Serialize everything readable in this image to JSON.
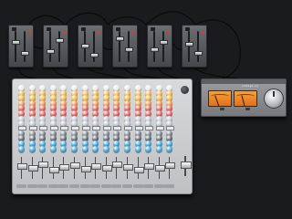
{
  "meter_unit": {
    "title": "vintage vu"
  },
  "mixer": {
    "brand": ""
  },
  "modules": [
    "m1",
    "m2",
    "m3",
    "m4",
    "m5",
    "m6"
  ],
  "colors": {
    "background": "#1a1b1d",
    "cable": "#0b0b0c",
    "knob_rows": [
      "#e8e9ea",
      "#f0b23a",
      "#f0b23a",
      "#ee8f3a",
      "#e25a56",
      "#e25a56",
      "#b9c3cf",
      "#b9c3cf",
      "#6f7a86",
      "#5a6470",
      "#3aa0d8",
      "#3aa0d8"
    ],
    "vu_face": "#f09a34"
  }
}
